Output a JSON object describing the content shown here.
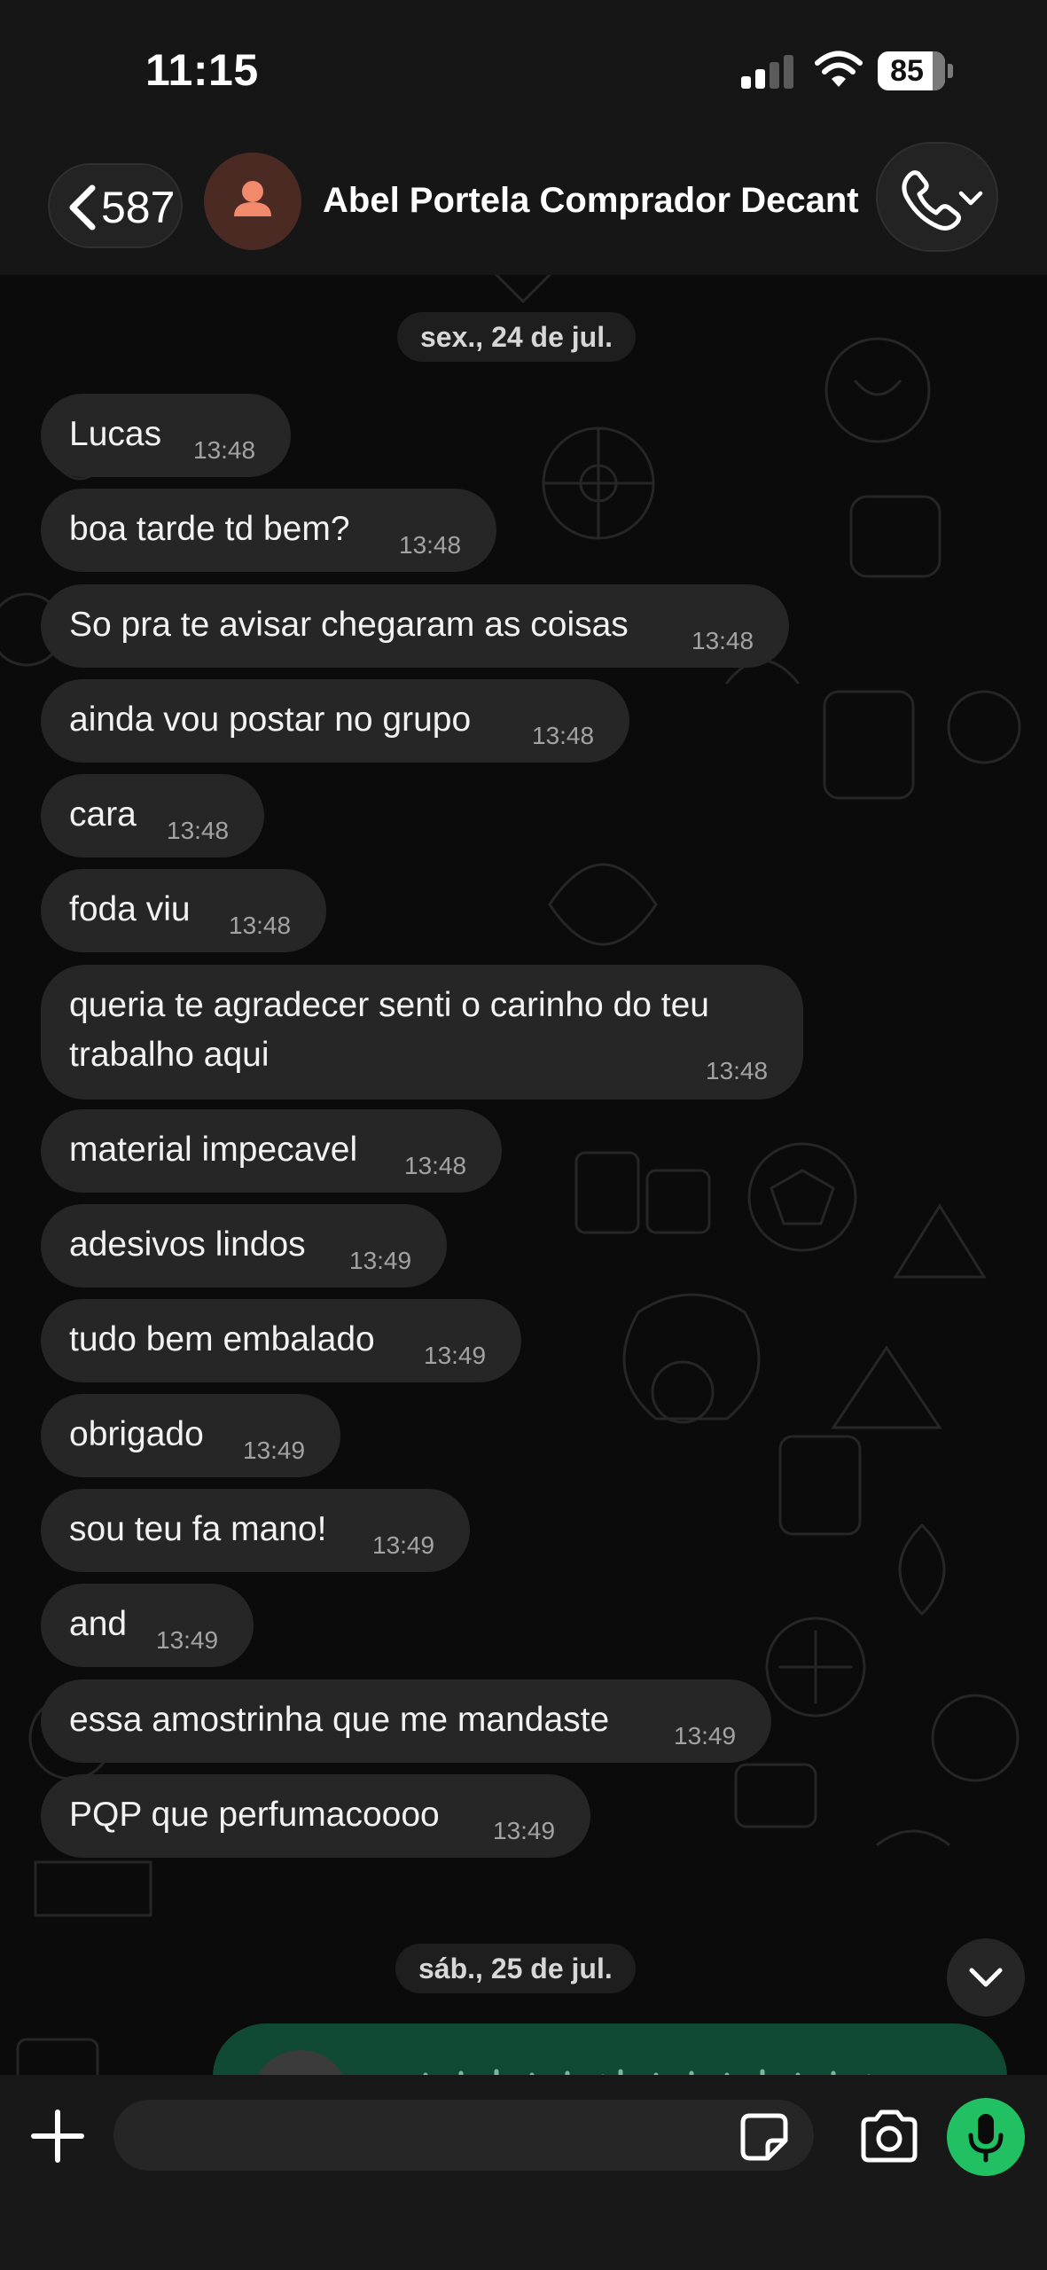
{
  "status_bar": {
    "time": "11:15",
    "battery": "85"
  },
  "header": {
    "back_count": "587",
    "contact_name": "Abel Portela Comprador Decant",
    "icons": [
      "chevron-left-icon",
      "person-icon",
      "phone-icon",
      "chevron-down-icon"
    ]
  },
  "chat": {
    "date_1": "sex., 24 de jul.",
    "date_2": "sáb., 25 de jul.",
    "messages": [
      {
        "text": "Lucas",
        "time": "13:48"
      },
      {
        "text": "boa tarde td bem?",
        "time": "13:48"
      },
      {
        "text": "So pra te avisar chegaram as coisas",
        "time": "13:48"
      },
      {
        "text": "ainda vou postar no grupo",
        "time": "13:48"
      },
      {
        "text": "cara",
        "time": "13:48"
      },
      {
        "text": "foda viu",
        "time": "13:48"
      },
      {
        "text": "queria te agradecer senti o carinho do teu trabalho aqui",
        "time": "13:48"
      },
      {
        "text": "material impecavel",
        "time": "13:48"
      },
      {
        "text": "adesivos lindos",
        "time": "13:49"
      },
      {
        "text": "tudo bem embalado",
        "time": "13:49"
      },
      {
        "text": "obrigado",
        "time": "13:49"
      },
      {
        "text": "sou teu fa mano!",
        "time": "13:49"
      },
      {
        "text": "and",
        "time": "13:49"
      },
      {
        "text": "essa amostrinha que me mandaste",
        "time": "13:49"
      },
      {
        "text": "PQP que perfumacoooo",
        "time": "13:49"
      }
    ]
  },
  "input_bar": {
    "placeholder": "",
    "icons": [
      "plus-icon",
      "sticker-icon",
      "camera-icon",
      "microphone-icon"
    ]
  },
  "colors": {
    "background": "#0b0b0b",
    "bubble_incoming": "#262626",
    "bubble_outgoing": "#104a35",
    "accent_green": "#21c063",
    "avatar_bg": "#4a2a22",
    "avatar_fg": "#f08a6a"
  }
}
